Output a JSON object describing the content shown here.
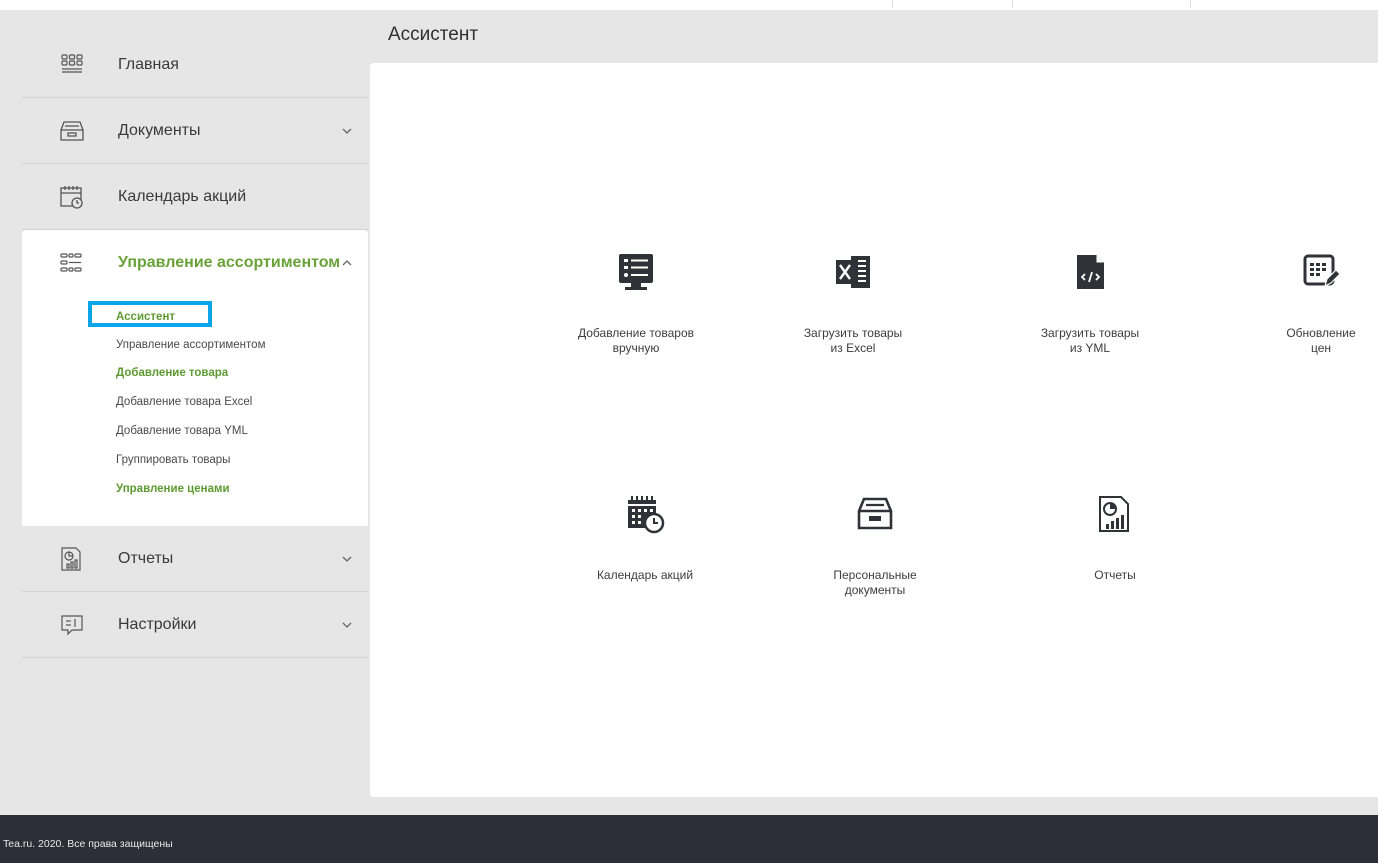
{
  "page_title": "Ассистент",
  "sidebar": {
    "items": [
      {
        "label": "Главная",
        "icon": "grid-keyboard-icon"
      },
      {
        "label": "Документы",
        "icon": "inbox-tray-icon",
        "chevron": "chevron-down-icon"
      },
      {
        "label": "Календарь акций",
        "icon": "calendar-clock-icon"
      },
      {
        "label": "Управление ассортиментом",
        "icon": "list-settings-icon",
        "chevron": "chevron-up-icon",
        "active": true
      },
      {
        "label": "Отчеты",
        "icon": "report-chart-icon",
        "chevron": "chevron-down-icon"
      },
      {
        "label": "Настройки",
        "icon": "chat-settings-icon",
        "chevron": "chevron-down-icon"
      }
    ],
    "subitems": [
      {
        "label": "Ассистент",
        "highlight": true
      },
      {
        "label": "Управление ассортиментом"
      },
      {
        "label": "Добавление товара",
        "highlight": true
      },
      {
        "label": "Добавление товара Excel"
      },
      {
        "label": "Добавление товара YML"
      },
      {
        "label": "Группировать товары"
      },
      {
        "label": "Управление ценами",
        "highlight": true
      }
    ]
  },
  "tiles": [
    {
      "line1": "Добавление товаров",
      "line2": "вручную",
      "icon": "list-monitor-icon"
    },
    {
      "line1": "Загрузить товары",
      "line2": "из Excel",
      "icon": "excel-icon"
    },
    {
      "line1": "Загрузить товары",
      "line2": "из YML",
      "icon": "code-file-icon"
    },
    {
      "line1": "Обновление",
      "line2": "цен",
      "icon": "table-edit-icon"
    },
    {
      "line1": "Календарь акций",
      "line2": "",
      "icon": "calendar-clock-icon"
    },
    {
      "line1": "Персональные",
      "line2": "документы",
      "icon": "inbox-tray-icon"
    },
    {
      "line1": "Отчеты",
      "line2": "",
      "icon": "report-chart-icon"
    }
  ],
  "footer": {
    "text": "Tea.ru. 2020. Все права защищены"
  },
  "colors": {
    "accent_green": "#6aa23a",
    "highlight_blue": "#0aa6e9",
    "footer_bg": "#2c2f38"
  }
}
